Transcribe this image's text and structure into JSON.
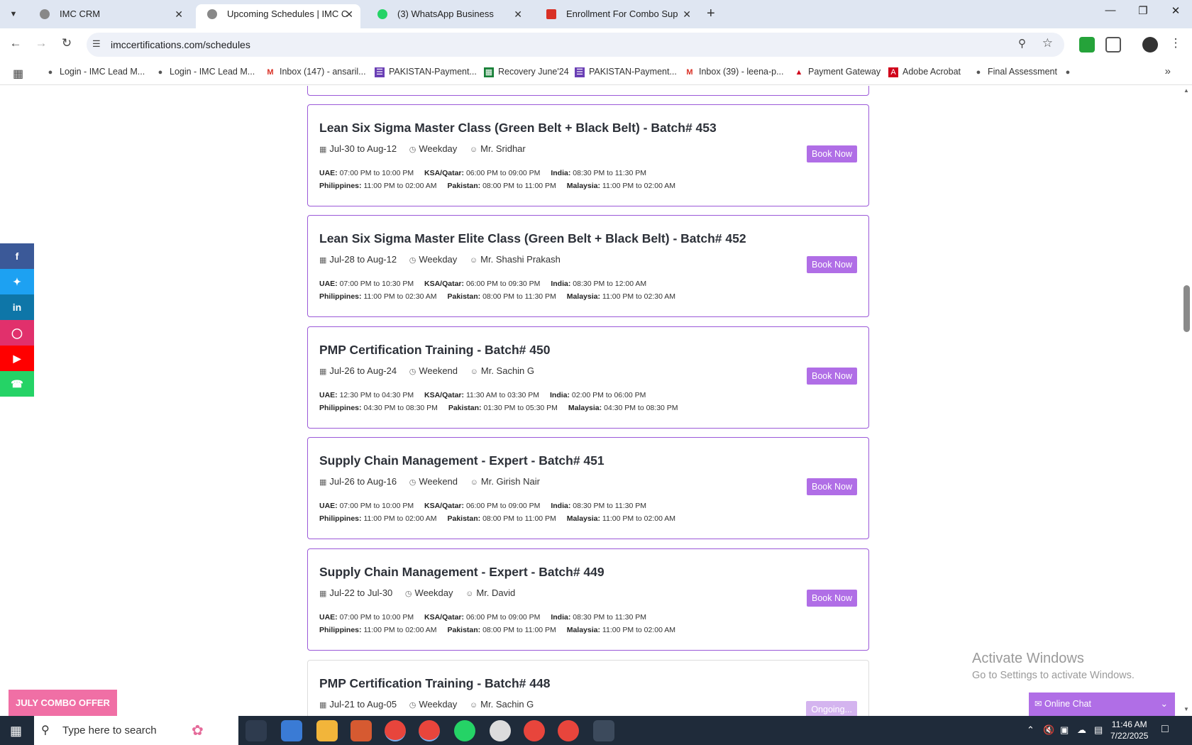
{
  "browser": {
    "tabs": [
      {
        "title": "IMC CRM",
        "active": false
      },
      {
        "title": "Upcoming Schedules | IMC Cert",
        "active": true
      },
      {
        "title": "(3) WhatsApp Business",
        "active": false
      },
      {
        "title": "Enrollment For Combo Supply C",
        "active": false
      }
    ],
    "url": "imccertifications.com/schedules",
    "bookmarks": [
      "Login - IMC Lead M...",
      "Login - IMC Lead M...",
      "Inbox (147) - ansaril...",
      "PAKISTAN-Payment...",
      "Recovery June'24",
      "PAKISTAN-Payment...",
      "Inbox (39) - leena-p...",
      "Payment Gateway",
      "Adobe Acrobat",
      "Final Assessment"
    ]
  },
  "schedules": [
    {
      "title": "Lean Six Sigma Master Class (Green Belt + Black Belt) - Batch# 453",
      "dates": "Jul-30 to Aug-12",
      "mode": "Weekday",
      "trainer": "Mr. Sridhar",
      "row1": [
        {
          "label": "UAE:",
          "time": "07:00 PM to 10:00 PM"
        },
        {
          "label": "KSA/Qatar:",
          "time": "06:00 PM to 09:00 PM"
        },
        {
          "label": "India:",
          "time": "08:30 PM to 11:30 PM"
        }
      ],
      "row2": [
        {
          "label": "Philippines:",
          "time": "11:00 PM to 02:00 AM"
        },
        {
          "label": "Pakistan:",
          "time": "08:00 PM to 11:00 PM"
        },
        {
          "label": "Malaysia:",
          "time": "11:00 PM to 02:00 AM"
        }
      ],
      "button": "Book Now"
    },
    {
      "title": "Lean Six Sigma Master Elite Class (Green Belt + Black Belt) - Batch# 452",
      "dates": "Jul-28 to Aug-12",
      "mode": "Weekday",
      "trainer": "Mr. Shashi Prakash",
      "row1": [
        {
          "label": "UAE:",
          "time": "07:00 PM to 10:30 PM"
        },
        {
          "label": "KSA/Qatar:",
          "time": "06:00 PM to 09:30 PM"
        },
        {
          "label": "India:",
          "time": "08:30 PM to 12:00 AM"
        }
      ],
      "row2": [
        {
          "label": "Philippines:",
          "time": "11:00 PM to 02:30 AM"
        },
        {
          "label": "Pakistan:",
          "time": "08:00 PM to 11:30 PM"
        },
        {
          "label": "Malaysia:",
          "time": "11:00 PM to 02:30 AM"
        }
      ],
      "button": "Book Now"
    },
    {
      "title": "PMP Certification Training - Batch# 450",
      "dates": "Jul-26 to Aug-24",
      "mode": "Weekend",
      "trainer": "Mr. Sachin G",
      "row1": [
        {
          "label": "UAE:",
          "time": "12:30 PM to 04:30 PM"
        },
        {
          "label": "KSA/Qatar:",
          "time": "11:30 AM to 03:30 PM"
        },
        {
          "label": "India:",
          "time": "02:00 PM to 06:00 PM"
        }
      ],
      "row2": [
        {
          "label": "Philippines:",
          "time": "04:30 PM to 08:30 PM"
        },
        {
          "label": "Pakistan:",
          "time": "01:30 PM to 05:30 PM"
        },
        {
          "label": "Malaysia:",
          "time": "04:30 PM to 08:30 PM"
        }
      ],
      "button": "Book Now"
    },
    {
      "title": "Supply Chain Management - Expert - Batch# 451",
      "dates": "Jul-26 to Aug-16",
      "mode": "Weekend",
      "trainer": "Mr. Girish Nair",
      "row1": [
        {
          "label": "UAE:",
          "time": "07:00 PM to 10:00 PM"
        },
        {
          "label": "KSA/Qatar:",
          "time": "06:00 PM to 09:00 PM"
        },
        {
          "label": "India:",
          "time": "08:30 PM to 11:30 PM"
        }
      ],
      "row2": [
        {
          "label": "Philippines:",
          "time": "11:00 PM to 02:00 AM"
        },
        {
          "label": "Pakistan:",
          "time": "08:00 PM to 11:00 PM"
        },
        {
          "label": "Malaysia:",
          "time": "11:00 PM to 02:00 AM"
        }
      ],
      "button": "Book Now"
    },
    {
      "title": "Supply Chain Management - Expert - Batch# 449",
      "dates": "Jul-22 to Jul-30",
      "mode": "Weekday",
      "trainer": "Mr. David",
      "row1": [
        {
          "label": "UAE:",
          "time": "07:00 PM to 10:00 PM"
        },
        {
          "label": "KSA/Qatar:",
          "time": "06:00 PM to 09:00 PM"
        },
        {
          "label": "India:",
          "time": "08:30 PM to 11:30 PM"
        }
      ],
      "row2": [
        {
          "label": "Philippines:",
          "time": "11:00 PM to 02:00 AM"
        },
        {
          "label": "Pakistan:",
          "time": "08:00 PM to 11:00 PM"
        },
        {
          "label": "Malaysia:",
          "time": "11:00 PM to 02:00 AM"
        }
      ],
      "button": "Book Now"
    },
    {
      "title": "PMP Certification Training - Batch# 448",
      "dates": "Jul-21 to Aug-05",
      "mode": "Weekday",
      "trainer": "Mr. Sachin G",
      "row1": [],
      "row2": [],
      "button": "Ongoing..."
    }
  ],
  "widgets": {
    "combo_offer": "JULY COMBO OFFER",
    "online_chat": "Online Chat",
    "watermark_title": "Activate Windows",
    "watermark_sub": "Go to Settings to activate Windows."
  },
  "social_icons": [
    "facebook-icon",
    "twitter-icon",
    "linkedin-icon",
    "instagram-icon",
    "youtube-icon",
    "whatsapp-icon"
  ],
  "colors": {
    "accent": "#b06ee6",
    "card_border": "#9b59d8",
    "combo": "#f06fa5"
  },
  "taskbar": {
    "search_placeholder": "Type here to search",
    "time": "11:46 AM",
    "date": "7/22/2025"
  }
}
